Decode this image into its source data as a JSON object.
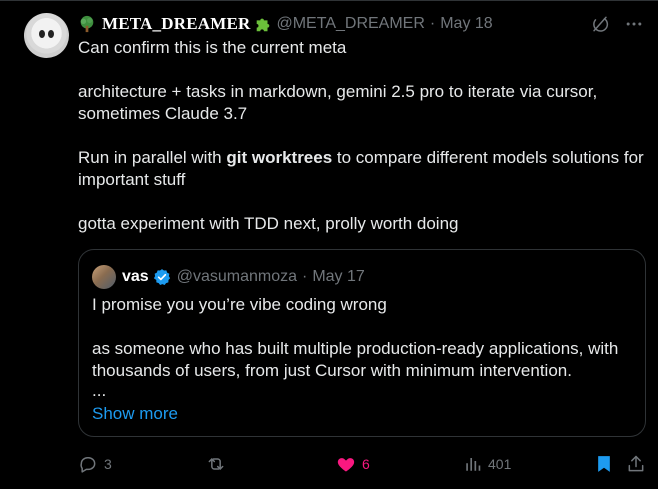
{
  "post": {
    "author": {
      "display_name": "META_DREAMER",
      "name_emojis": [
        "tree-emoji",
        "puzzle-piece-emoji"
      ],
      "handle": "@META_DREAMER",
      "date": "May 18"
    },
    "text": {
      "line1": "Can confirm this is the current meta",
      "line2": "architecture + tasks in markdown, gemini 2.5 pro to iterate via cursor, sometimes Claude 3.7",
      "line3_before": "Run in parallel with ",
      "line3_bold": "git worktrees",
      "line3_after": " to compare different models solutions for important stuff",
      "line4": "gotta experiment with TDD next, prolly worth doing"
    },
    "separator": "·"
  },
  "quote": {
    "author": {
      "display_name": "vas",
      "handle": "@vasumanmoza",
      "date": "May 17",
      "verified": true
    },
    "text": {
      "line1": "I promise you you’re vibe coding wrong",
      "line2": "as someone who has built multiple production-ready applications, with thousands of users, from just Cursor with minimum intervention.",
      "ellipsis": "..."
    },
    "show_more": "Show more"
  },
  "actions": {
    "reply_count": "3",
    "repost_count": "",
    "like_count": "6",
    "views_count": "401"
  },
  "colors": {
    "background": "#000000",
    "text": "#e7e9ea",
    "muted": "#71767b",
    "accent": "#1d9bf0",
    "like": "#f91880",
    "border": "#2f3336"
  },
  "icons": {
    "top_right": [
      "grok-slash-icon",
      "more-icon"
    ],
    "actions": [
      "reply-icon",
      "repost-icon",
      "like-heart-icon",
      "views-icon",
      "bookmark-icon",
      "share-icon"
    ]
  }
}
